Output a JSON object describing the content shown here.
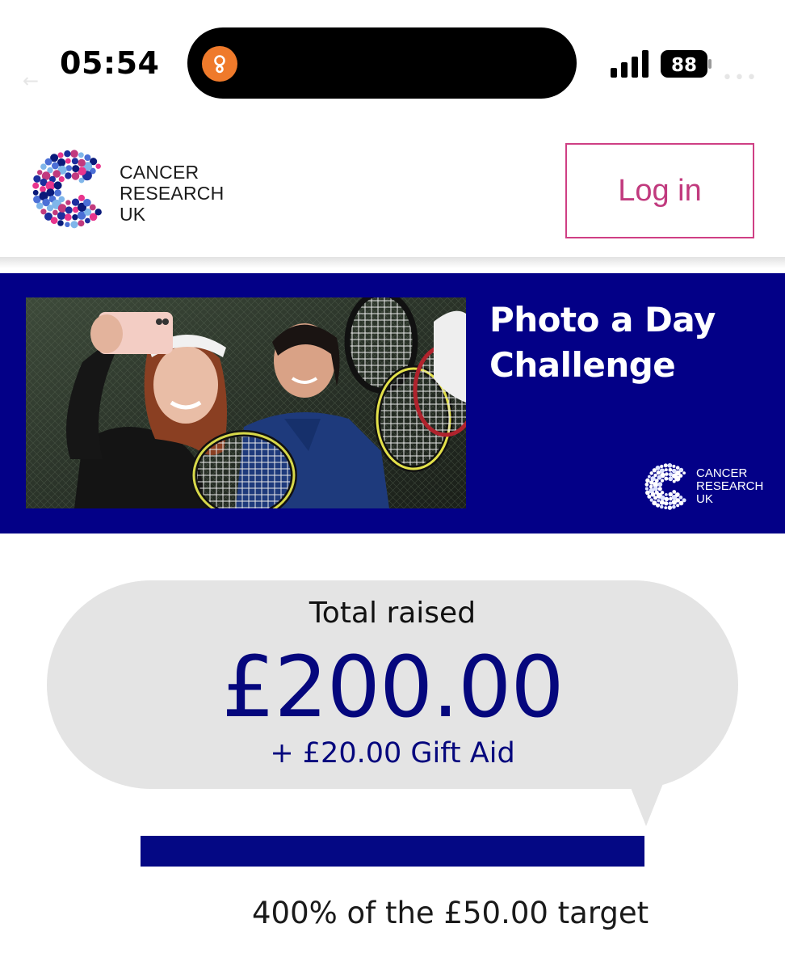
{
  "status_bar": {
    "time": "05:54",
    "battery_level": "88",
    "island_app_icon": "location-pin-icon"
  },
  "header": {
    "logo_lines": [
      "CANCER",
      "RESEARCH",
      "UK"
    ],
    "login_label": "Log in",
    "brand_colors": {
      "magenta": "#cf3f84",
      "navy": "#030087"
    }
  },
  "banner": {
    "title_lines": [
      "Photo a Day",
      "Challenge"
    ],
    "logo_lines": [
      "CANCER",
      "RESEARCH",
      "UK"
    ],
    "background_color": "#030087"
  },
  "fundraising": {
    "total_label": "Total raised",
    "total_amount": "£200.00",
    "gift_aid": "+ £20.00 Gift Aid",
    "progress_fraction": 1.0,
    "target_text": "400% of the £50.00 target"
  }
}
